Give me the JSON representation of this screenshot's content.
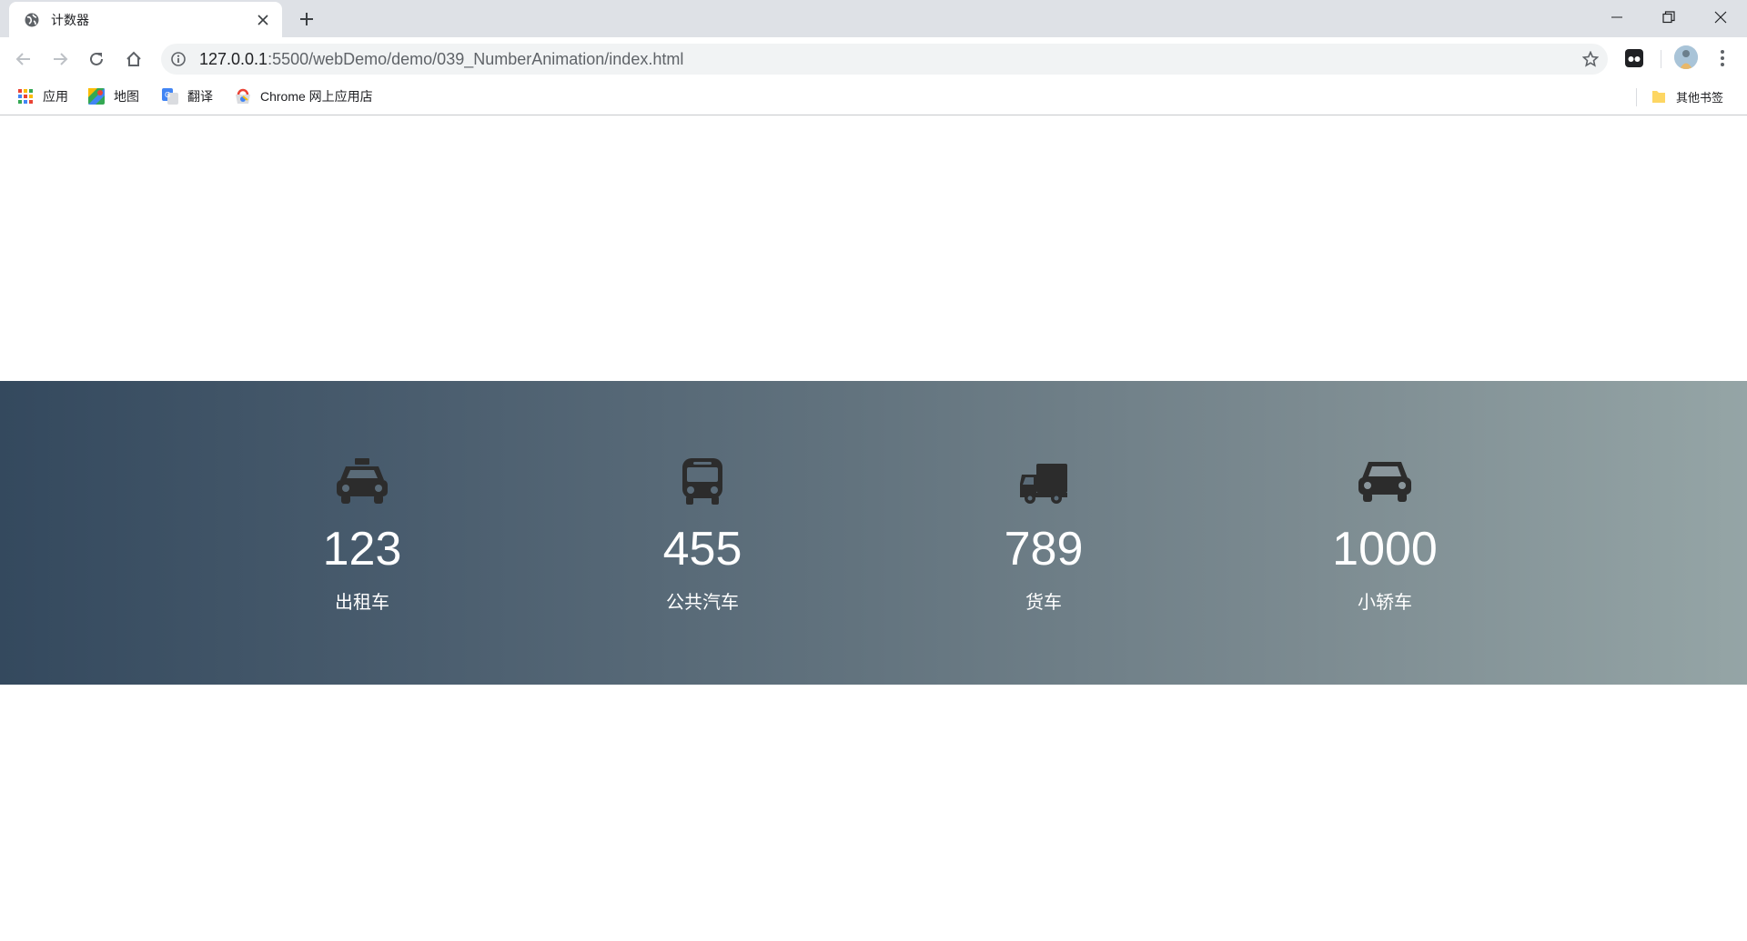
{
  "browser": {
    "tab": {
      "title": "计数器"
    },
    "address_bar": {
      "url_host": "127.0.0.1",
      "url_rest": ":5500/webDemo/demo/039_NumberAnimation/index.html"
    },
    "bookmarks": [
      {
        "label": "应用",
        "icon": "apps-grid-icon"
      },
      {
        "label": "地图",
        "icon": "maps-icon"
      },
      {
        "label": "翻译",
        "icon": "translate-icon"
      },
      {
        "label": "Chrome 网上应用店",
        "icon": "webstore-icon"
      }
    ],
    "other_bookmarks": "其他书签"
  },
  "counters": [
    {
      "icon": "taxi-icon",
      "value": "123",
      "label": "出租车"
    },
    {
      "icon": "bus-icon",
      "value": "455",
      "label": "公共汽车"
    },
    {
      "icon": "truck-icon",
      "value": "789",
      "label": "货车"
    },
    {
      "icon": "car-icon",
      "value": "1000",
      "label": "小轿车"
    }
  ],
  "colors": {
    "gradient_start": "#34495e",
    "gradient_end": "#95a5a6",
    "icon": "#2c2c2c",
    "text": "#ffffff"
  }
}
